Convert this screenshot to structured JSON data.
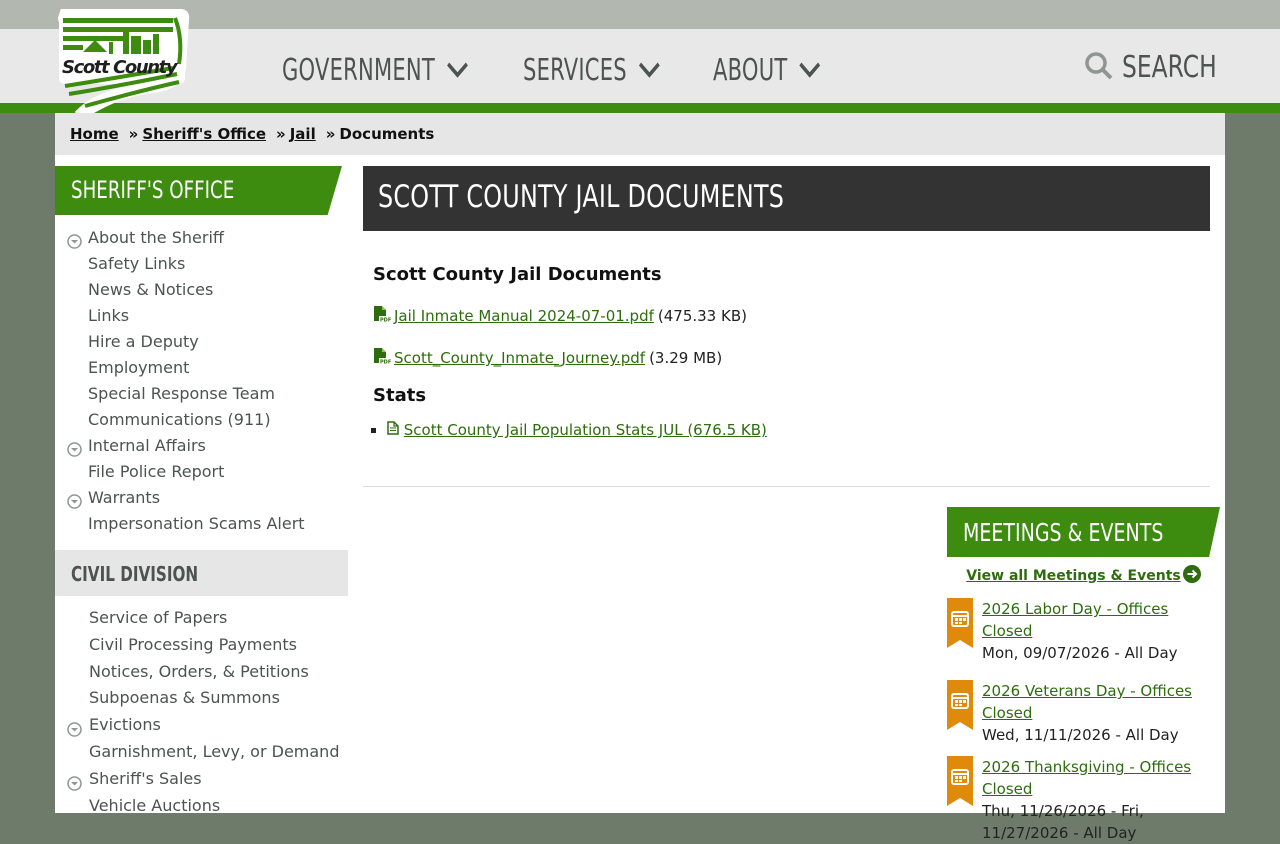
{
  "header": {
    "logo_text": "Scott County",
    "nav": [
      {
        "label": "GOVERNMENT"
      },
      {
        "label": "SERVICES"
      },
      {
        "label": "ABOUT"
      }
    ],
    "search_label": "SEARCH"
  },
  "breadcrumb": {
    "home": "Home",
    "sheriff": "Sheriff's Office",
    "jail": "Jail",
    "current": "Documents",
    "sep": "»"
  },
  "sidebar": {
    "heading": "SHERIFF'S OFFICE",
    "items": [
      {
        "label": "About the Sheriff",
        "expandable": true
      },
      {
        "label": "Safety Links"
      },
      {
        "label": "News & Notices"
      },
      {
        "label": "Links"
      },
      {
        "label": "Hire a Deputy"
      },
      {
        "label": "Employment"
      },
      {
        "label": "Special Response Team"
      },
      {
        "label": "Communications (911)"
      },
      {
        "label": "Internal Affairs",
        "expandable": true
      },
      {
        "label": "File Police Report"
      },
      {
        "label": "Warrants",
        "expandable": true
      },
      {
        "label": "Impersonation Scams Alert"
      }
    ],
    "civil_heading": "CIVIL DIVISION",
    "civil_items": [
      {
        "label": "Service of Papers"
      },
      {
        "label": "Civil Processing Payments"
      },
      {
        "label": "Notices, Orders, & Petitions"
      },
      {
        "label": "Subpoenas & Summons"
      },
      {
        "label": "Evictions",
        "expandable": true
      },
      {
        "label": "Garnishment, Levy, or Demand"
      },
      {
        "label": "Sheriff's Sales",
        "expandable": true
      },
      {
        "label": "Vehicle Auctions"
      }
    ]
  },
  "main": {
    "title": "SCOTT COUNTY JAIL DOCUMENTS",
    "section1_heading": "Scott County Jail Documents",
    "files": [
      {
        "name": "Jail Inmate Manual 2024-07-01.pdf",
        "size": "(475.33 KB)"
      },
      {
        "name": "Scott_County_Inmate_Journey.pdf",
        "size": "(3.29 MB)"
      }
    ],
    "section2_heading": "Stats",
    "stats": [
      {
        "label": "Scott County Jail Population Stats JUL (676.5 KB)"
      }
    ]
  },
  "events": {
    "heading": "MEETINGS & EVENTS",
    "view_all": "View all Meetings & Events",
    "items": [
      {
        "title": "2026 Labor Day - Offices Closed",
        "date": "Mon, 09/07/2026 - All Day"
      },
      {
        "title": "2026 Veterans Day - Offices Closed",
        "date": "Wed, 11/11/2026 - All Day"
      },
      {
        "title": "2026 Thanksgiving - Offices Closed",
        "date": "Thu, 11/26/2026 - Fri, 11/27/2026 - All Day"
      }
    ]
  },
  "colors": {
    "brand_green": "#3d8b0f",
    "link_green": "#2e6d0e",
    "event_orange": "#e08a0c",
    "title_dark": "#333333"
  }
}
